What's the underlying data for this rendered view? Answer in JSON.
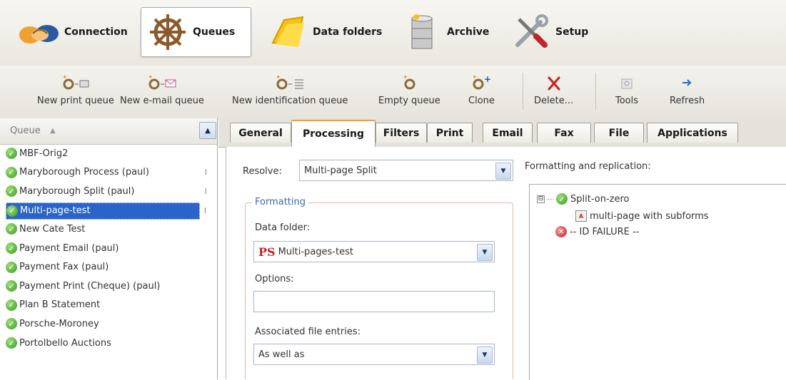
{
  "nav": {
    "items": [
      {
        "label": "Connection",
        "icon": "handshake-icon",
        "active": false
      },
      {
        "label": "Queues",
        "icon": "ship-wheel-icon",
        "active": true
      },
      {
        "label": "Data folders",
        "icon": "folder-icon",
        "active": false
      },
      {
        "label": "Archive",
        "icon": "database-icon",
        "active": false
      },
      {
        "label": "Setup",
        "icon": "tools-icon",
        "active": false
      }
    ]
  },
  "toolbar": {
    "items": [
      {
        "label": "New print queue",
        "icon": "new-print-queue-icon"
      },
      {
        "label": "New e-mail queue",
        "icon": "new-email-queue-icon"
      },
      {
        "label": "New identification queue",
        "icon": "new-identification-queue-icon"
      },
      {
        "label": "Empty queue",
        "icon": "empty-queue-icon"
      },
      {
        "label": "Clone",
        "icon": "clone-icon"
      },
      {
        "label": "Delete...",
        "icon": "delete-icon"
      },
      {
        "label": "Tools",
        "icon": "tools-icon"
      },
      {
        "label": "Refresh",
        "icon": "refresh-icon"
      }
    ]
  },
  "queue_list": {
    "header": "Queue",
    "sort_indicator": "▲",
    "scroll_up": "▲",
    "items": [
      {
        "label": "MBF-Orig2",
        "tail": ""
      },
      {
        "label": "Maryborough Process (paul)",
        "tail": "I"
      },
      {
        "label": "Maryborough Split (paul)",
        "tail": "I"
      },
      {
        "label": "Multi-page-test",
        "tail": "I",
        "selected": true
      },
      {
        "label": "New Cate Test",
        "tail": ""
      },
      {
        "label": "Payment Email (paul)",
        "tail": ""
      },
      {
        "label": "Payment Fax (paul)",
        "tail": ""
      },
      {
        "label": "Payment Print (Cheque) (paul)",
        "tail": ""
      },
      {
        "label": "Plan B Statement",
        "tail": ""
      },
      {
        "label": "Porsche-Moroney",
        "tail": ""
      },
      {
        "label": "Portolbello Auctions",
        "tail": ""
      }
    ]
  },
  "tabs": [
    {
      "label": "General",
      "active": false
    },
    {
      "label": "Processing",
      "active": true
    },
    {
      "label": "Filters",
      "active": false
    },
    {
      "label": "Print",
      "active": false
    },
    {
      "label": "Email",
      "active": false
    },
    {
      "label": "Fax",
      "active": false
    },
    {
      "label": "File",
      "active": false
    },
    {
      "label": "Applications",
      "active": false
    }
  ],
  "processing": {
    "resolve_label": "Resolve:",
    "resolve_value": "Multi-page Split",
    "formatting_legend": "Formatting",
    "data_folder_label": "Data folder:",
    "data_folder_badge": "PS",
    "data_folder_value": "Multi-pages-test",
    "options_label": "Options:",
    "options_value": "",
    "assoc_label": "Associated file entries:",
    "assoc_value": "As well as",
    "replication_label": "Formatting and replication:",
    "tree": {
      "toggle": "⊟",
      "split_node": "Split-on-zero",
      "form_node": "multi-page with subforms",
      "failure_node": "-- ID FAILURE --"
    }
  },
  "colors": {
    "selection": "#2b64c8",
    "active_tab_accent": "#e9a23b",
    "legend": "#3d66b0",
    "check_green": "#3c9a1e",
    "error_red": "#c0252a"
  }
}
